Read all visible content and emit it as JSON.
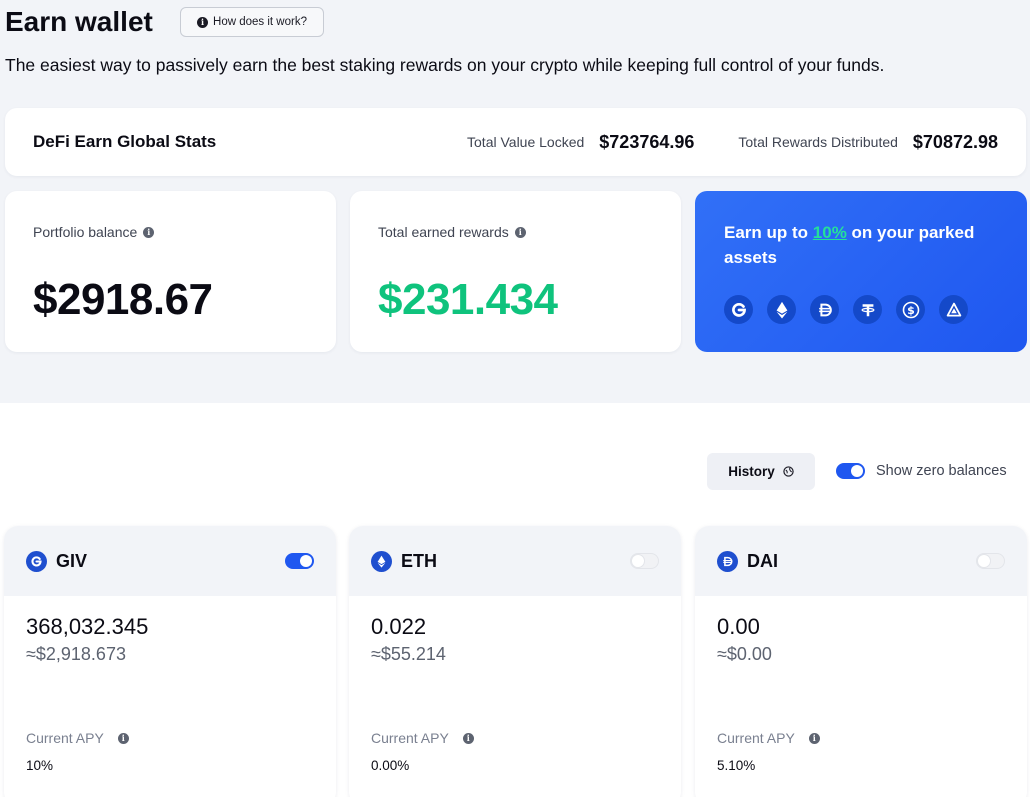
{
  "header": {
    "title": "Earn wallet",
    "how_label": "How does it work?",
    "subtitle": "The easiest way to passively earn the best staking rewards on your crypto while keeping full control of your funds."
  },
  "global_stats": {
    "title": "DeFi Earn Global Stats",
    "tvl_label": "Total Value Locked",
    "tvl_value": "$723764.96",
    "rewards_label": "Total Rewards Distributed",
    "rewards_value": "$70872.98"
  },
  "portfolio": {
    "label": "Portfolio balance",
    "value": "$2918.67"
  },
  "earned": {
    "label": "Total earned rewards",
    "value": "$231.434",
    "color": "#0fc37d"
  },
  "promo": {
    "prefix": "Earn up to ",
    "percent": "10%",
    "suffix": " on your parked assets",
    "icons": [
      "giv-icon",
      "eth-icon",
      "dai-icon",
      "usdt-icon",
      "usdc-icon",
      "bat-icon"
    ]
  },
  "controls": {
    "history_label": "History",
    "zero_label": "Show zero balances",
    "zero_on": true
  },
  "assets": [
    {
      "symbol": "GIV",
      "icon": "giv-icon",
      "enabled": true,
      "amount": "368,032.345",
      "usd": "≈$2,918.673",
      "apy_label": "Current APY",
      "apy": "10%"
    },
    {
      "symbol": "ETH",
      "icon": "eth-icon",
      "enabled": false,
      "amount": "0.022",
      "usd": "≈$55.214",
      "apy_label": "Current APY",
      "apy": "0.00%"
    },
    {
      "symbol": "DAI",
      "icon": "dai-icon",
      "enabled": false,
      "amount": "0.00",
      "usd": "≈$0.00",
      "apy_label": "Current APY",
      "apy": "5.10%"
    }
  ],
  "colors": {
    "accent": "#1f57f0",
    "background": "#f2f4f8"
  }
}
